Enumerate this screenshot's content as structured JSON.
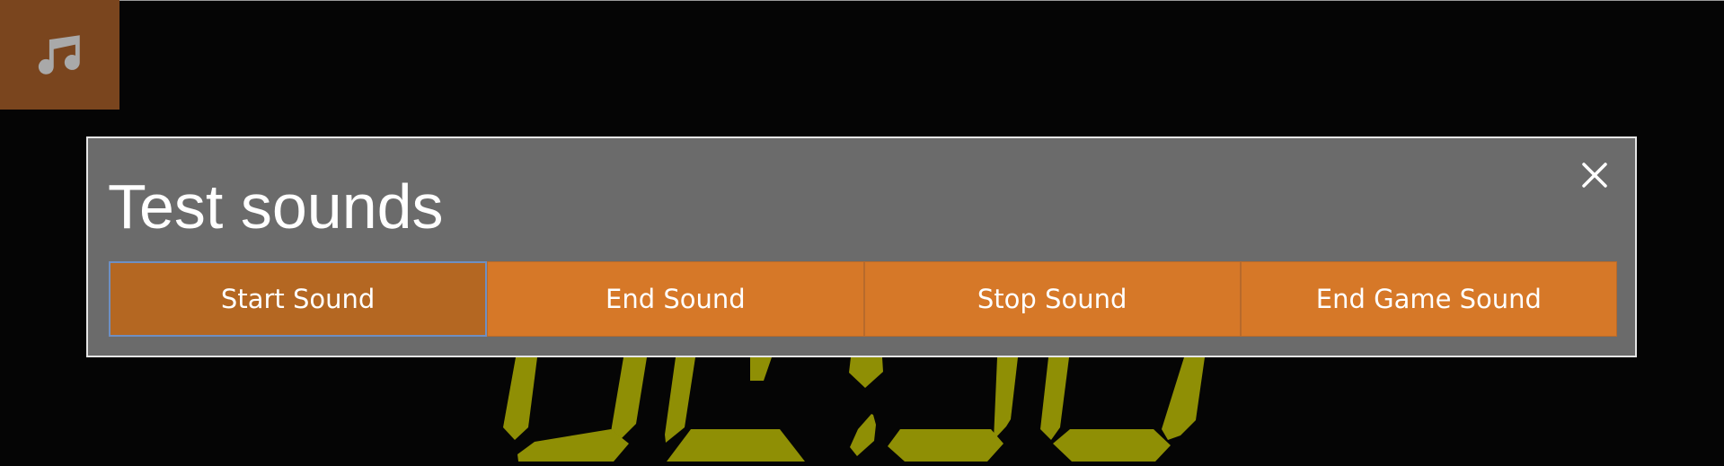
{
  "colors": {
    "background": "#050505",
    "music_button": "#7a451e",
    "dialog_background": "#6b6b6b",
    "button": "#d67828",
    "button_focused": "#b46722",
    "clock_digits": "#8f8f05"
  },
  "music_button": {
    "icon": "music-note-icon"
  },
  "dialog": {
    "title": "Test sounds",
    "close_icon": "close-icon",
    "buttons": [
      {
        "label": "Start Sound",
        "focused": true
      },
      {
        "label": "End Sound",
        "focused": false
      },
      {
        "label": "Stop Sound",
        "focused": false
      },
      {
        "label": "End Game Sound",
        "focused": false
      }
    ]
  }
}
